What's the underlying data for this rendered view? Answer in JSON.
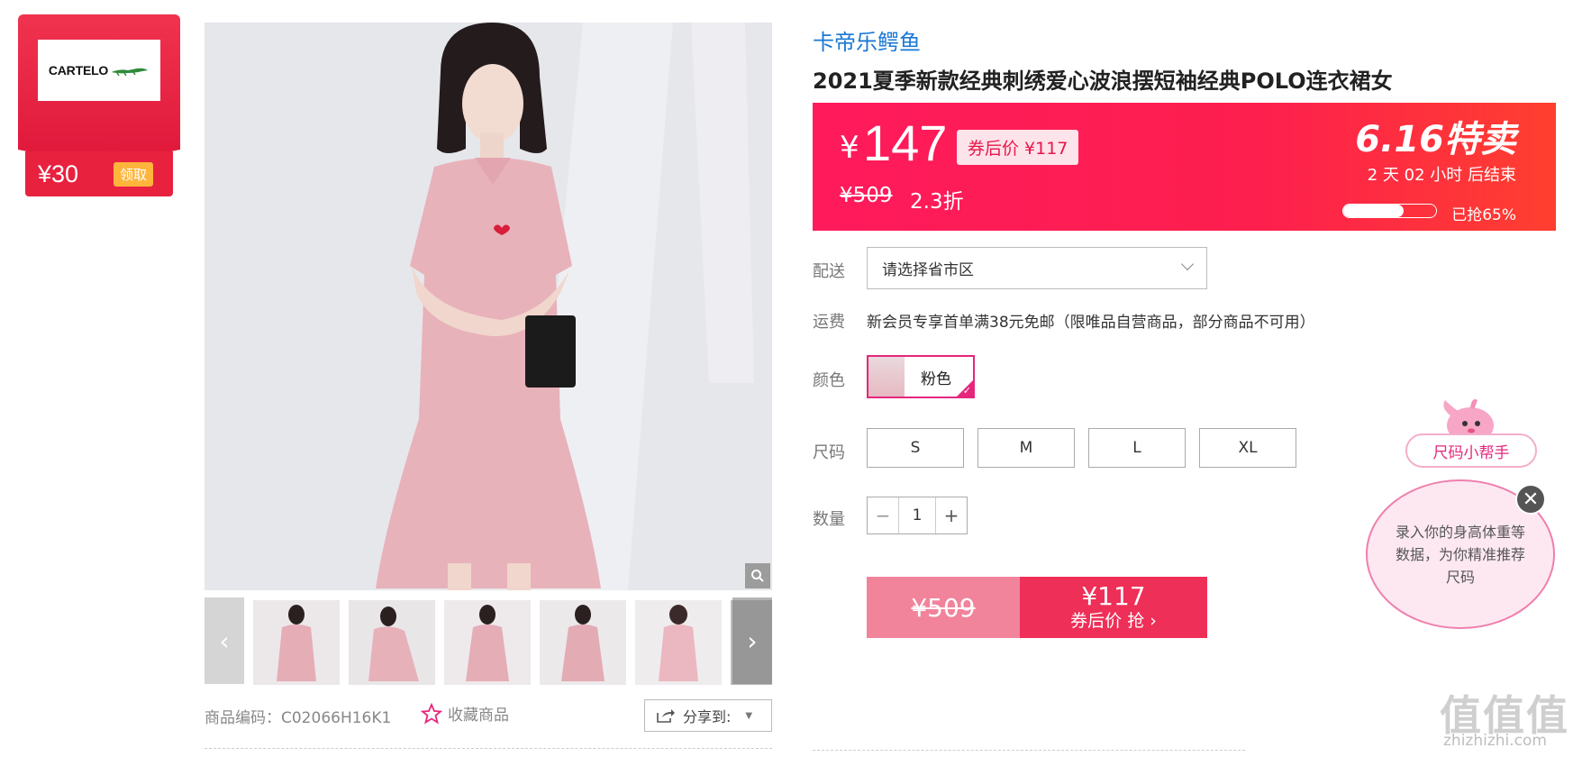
{
  "coupon": {
    "brand_logo_text": "CARTELO",
    "amount": "¥30",
    "claim_label": "领取"
  },
  "gallery": {
    "thumbnail_count": 6
  },
  "product_code": "商品编码：C02066H16K1",
  "favorite_label": "收藏商品",
  "share_label": "分享到:",
  "brand": "卡帝乐鳄鱼",
  "title": "2021夏季新款经典刺绣爱心波浪摆短袖经典POLO连衣裙女",
  "price_banner": {
    "currency": "¥",
    "price": "147",
    "coupon_price": "券后价 ¥117",
    "original_price": "¥509",
    "discount": "2.3折",
    "promo_title": "6.16特卖",
    "countdown": "2 天 02 小时 后结束",
    "sold_progress": 65,
    "sold_text": "已抢65%"
  },
  "delivery": {
    "label": "配送",
    "placeholder": "请选择省市区"
  },
  "shipping": {
    "label": "运费",
    "text": "新会员专享首单满38元免邮（限唯品自营商品，部分商品不可用）"
  },
  "color": {
    "label": "颜色",
    "selected": "粉色"
  },
  "size": {
    "label": "尺码",
    "options": [
      "S",
      "M",
      "L",
      "XL"
    ]
  },
  "quantity": {
    "label": "数量",
    "value": "1",
    "minus": "−",
    "plus": "+"
  },
  "buy": {
    "original_price": "¥509",
    "coupon_price": "¥117",
    "action": "券后价 抢 ›"
  },
  "size_helper": {
    "title": "尺码小帮手",
    "message": "录入你的身高体重等数据，为你精准推荐尺码",
    "close": "✕"
  },
  "watermark": {
    "text": "值值值",
    "url": "zhizhizhi.com"
  },
  "colors": {
    "accent_pink": "#e5277c",
    "banner_red": "#ff1a5c",
    "brand_blue": "#1a78d4"
  }
}
